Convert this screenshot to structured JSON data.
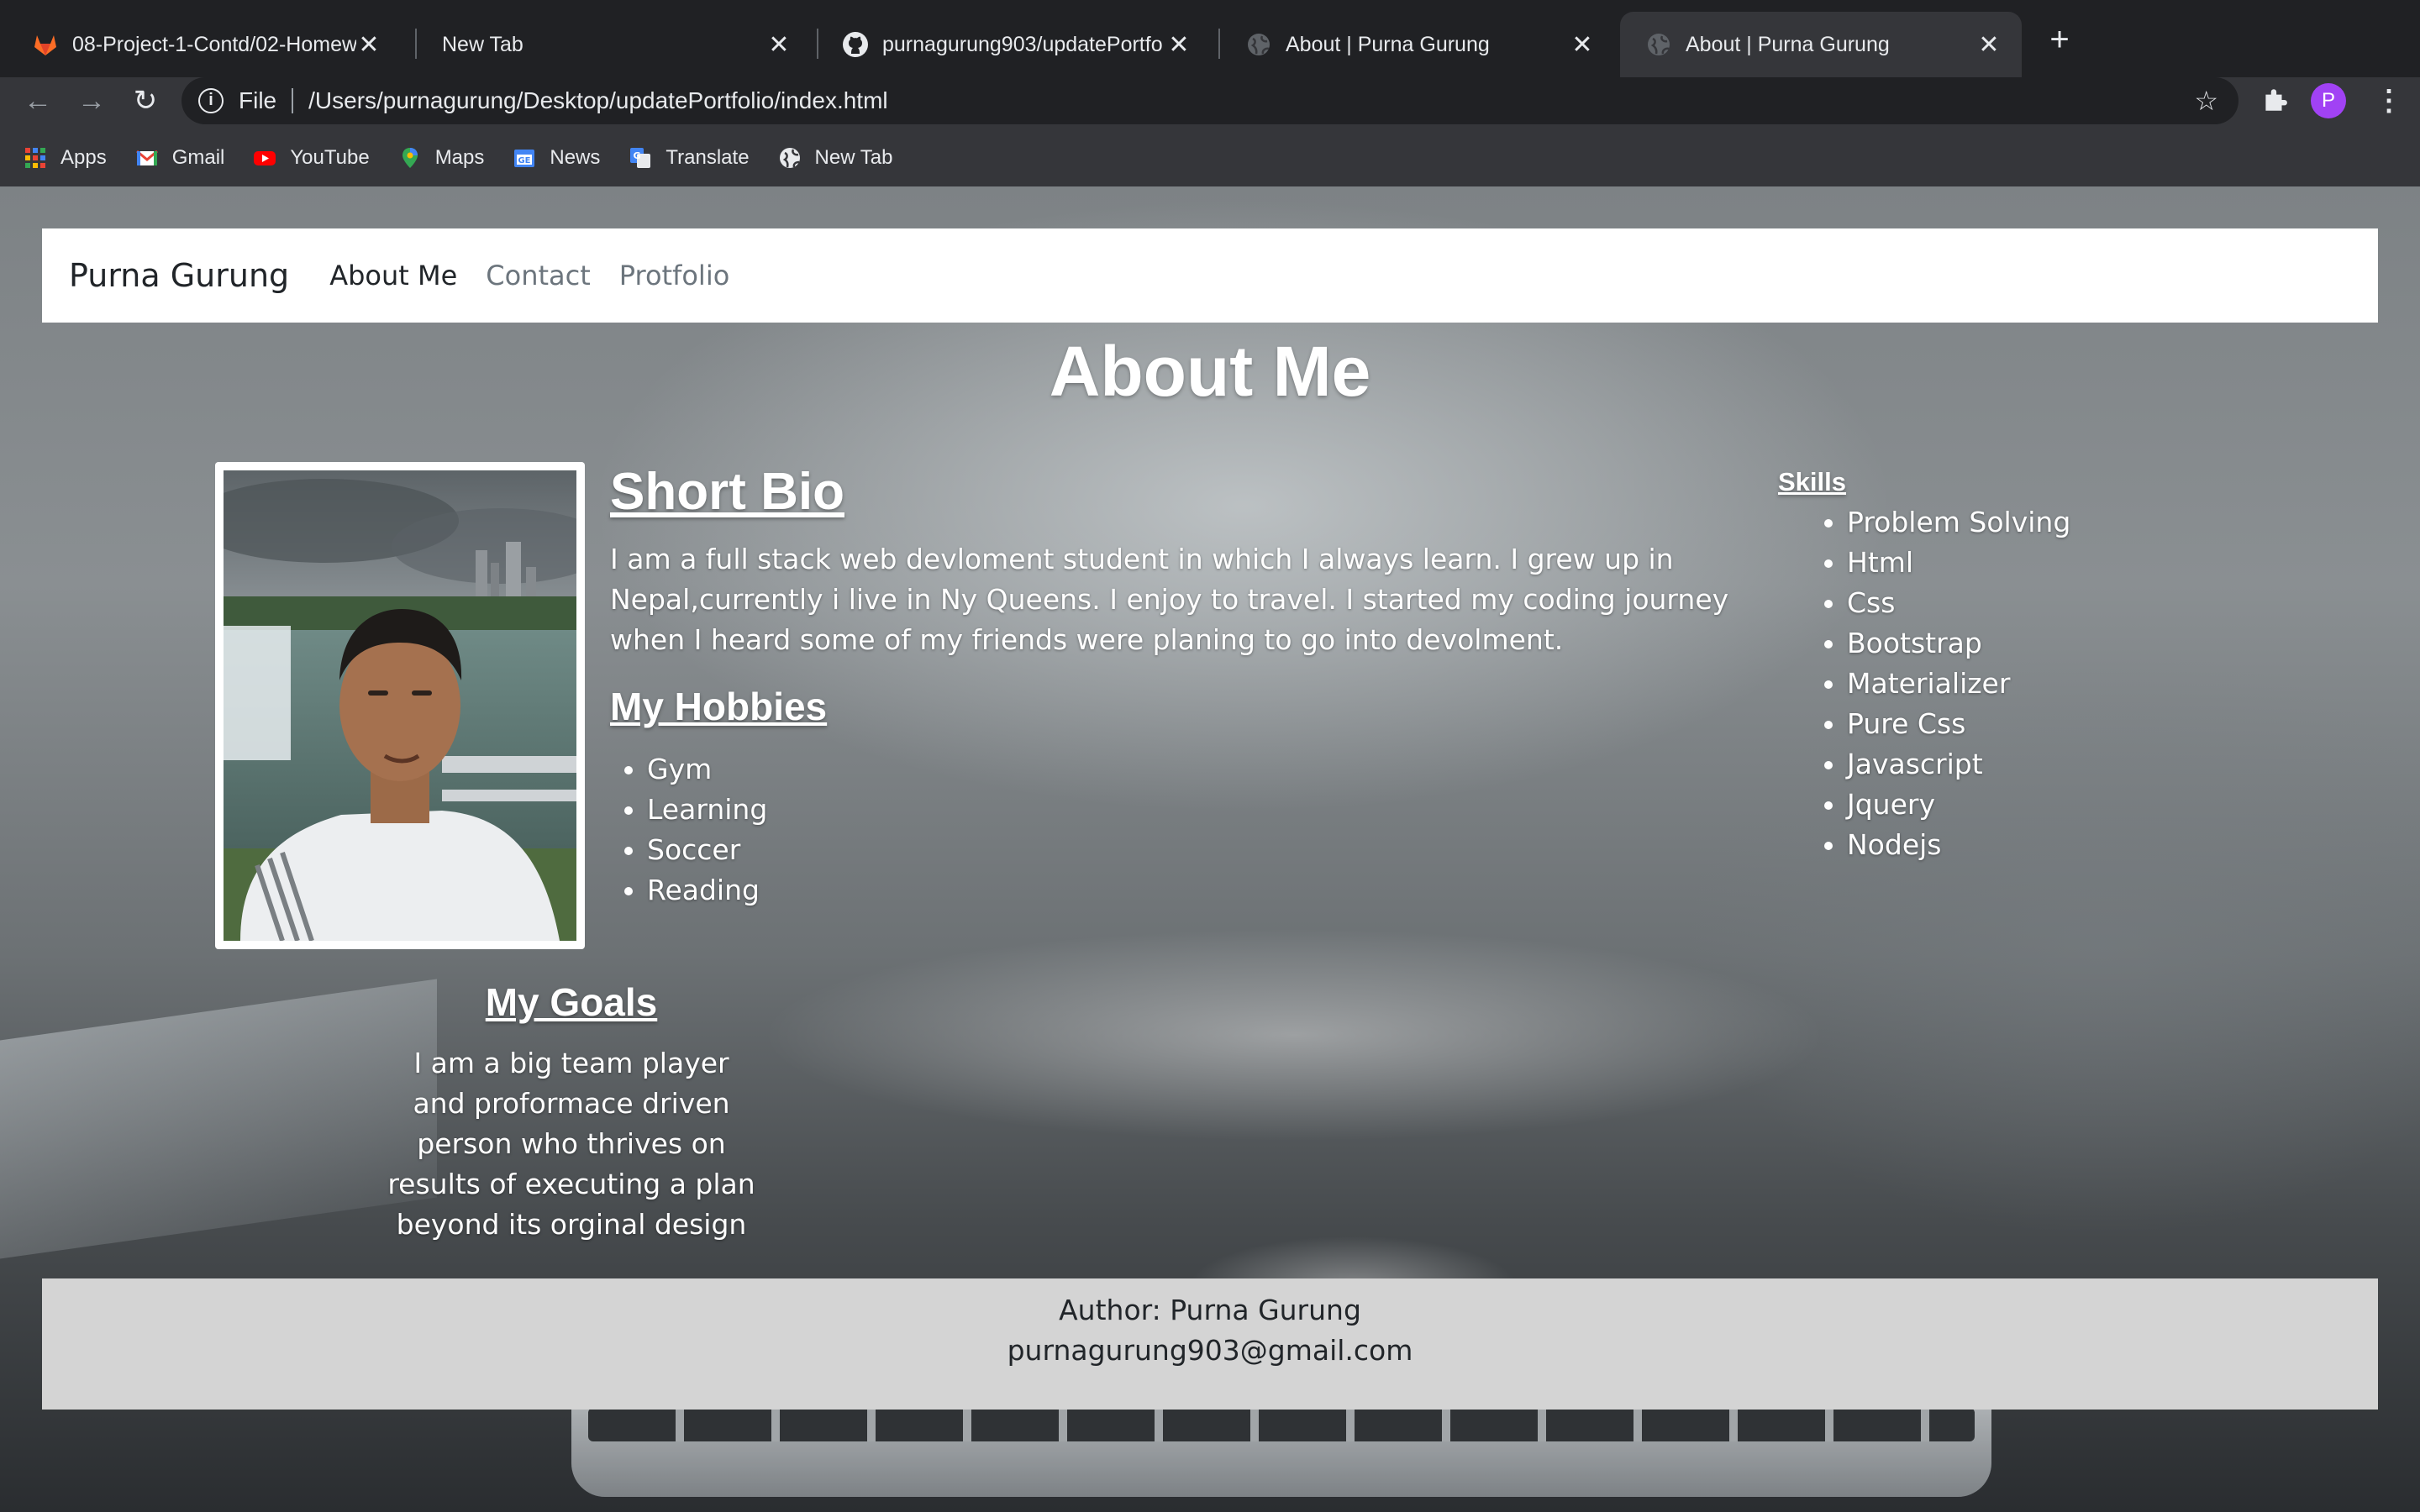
{
  "browser": {
    "tabs": [
      {
        "title": "08-Project-1-Contd/02-Homew",
        "icon": "gitlab-icon",
        "active": false
      },
      {
        "title": "New Tab",
        "icon": "",
        "active": false
      },
      {
        "title": "purnagurung903/updatePortfo",
        "icon": "github-icon",
        "active": false
      },
      {
        "title": "About | Purna Gurung",
        "icon": "globe-icon",
        "active": false
      },
      {
        "title": "About | Purna Gurung",
        "icon": "globe-icon",
        "active": true
      }
    ],
    "close_glyph": "✕",
    "new_tab_glyph": "+",
    "omnibox": {
      "scheme": "File",
      "url": "/Users/purnagurung/Desktop/updatePortfolio/index.html"
    },
    "profile_initial": "P",
    "bookmarks": [
      {
        "label": "Apps",
        "icon": "apps-grid-icon"
      },
      {
        "label": "Gmail",
        "icon": "gmail-icon"
      },
      {
        "label": "YouTube",
        "icon": "youtube-icon"
      },
      {
        "label": "Maps",
        "icon": "maps-icon"
      },
      {
        "label": "News",
        "icon": "news-icon"
      },
      {
        "label": "Translate",
        "icon": "translate-icon"
      },
      {
        "label": "New Tab",
        "icon": "globe-icon"
      }
    ]
  },
  "page": {
    "navbar": {
      "brand": "Purna Gurung",
      "links": [
        "About Me",
        "Contact",
        "Protfolio"
      ]
    },
    "title": "About Me",
    "bio": {
      "heading": "Short Bio",
      "text": "I am a full stack web devloment student in which I always learn. I grew up in Nepal,currently i live in Ny Queens. I enjoy to travel. I started my coding journey when I heard some of my friends were planing to go into devolment."
    },
    "hobbies": {
      "heading": "My Hobbies",
      "items": [
        "Gym",
        "Learning",
        "Soccer",
        "Reading"
      ]
    },
    "skills": {
      "heading": "Skills",
      "items": [
        "Problem Solving",
        "Html",
        "Css",
        "Bootstrap",
        "Materializer",
        "Pure Css",
        "Javascript",
        "Jquery",
        "Nodejs"
      ]
    },
    "goals": {
      "heading": "My Goals",
      "text": "I am a big team player and proformace driven person who thrives on results of executing a plan beyond its orginal design"
    },
    "footer": {
      "author": "Author: Purna Gurung",
      "email": "purnagurung903@gmail.com"
    }
  },
  "colors": {
    "chrome_dark": "#202124",
    "chrome_tab_active": "#35363a",
    "navbar_bg": "#ffffff",
    "footer_bg": "#d4d4d4"
  }
}
